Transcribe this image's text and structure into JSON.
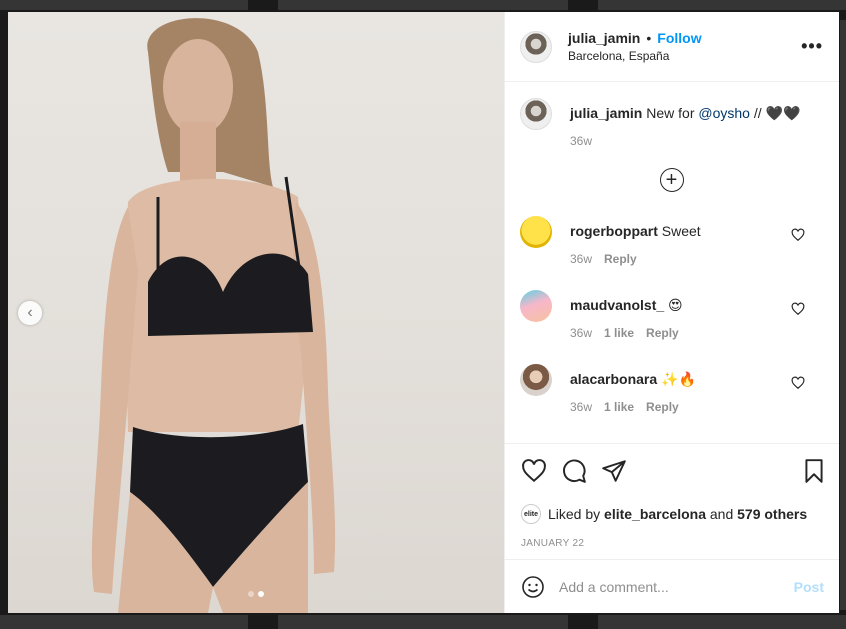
{
  "post": {
    "author": "julia_jamin",
    "follow_label": "Follow",
    "separator": "•",
    "location": "Barcelona, España",
    "more_label": "•••"
  },
  "caption": {
    "author": "julia_jamin",
    "text_prefix": "New for ",
    "mention": "@oysho",
    "text_suffix": " // 🖤🖤",
    "age": "36w"
  },
  "load_more_label": "+",
  "comments": [
    {
      "user": "rogerboppart",
      "text": "Sweet",
      "age": "36w",
      "likes": "",
      "reply": "Reply"
    },
    {
      "user": "maudvanolst_",
      "text": "😍",
      "age": "36w",
      "likes": "1 like",
      "reply": "Reply"
    },
    {
      "user": "alacarbonara",
      "text": "✨🔥",
      "age": "36w",
      "likes": "1 like",
      "reply": "Reply"
    }
  ],
  "likes": {
    "prefix": "Liked by ",
    "user": "elite_barcelona",
    "middle": " and ",
    "others": "579 others",
    "avatar_text": "elite"
  },
  "date": "JANUARY 22",
  "add_comment": {
    "placeholder": "Add a comment...",
    "post_label": "Post",
    "emoji_icon": "smiley-icon"
  },
  "carousel": {
    "prev_label": "‹",
    "slide_count": 2,
    "active_slide": 2
  },
  "colors": {
    "link": "#0095f6",
    "mention": "#00376b",
    "post_disabled": "#b2dffc",
    "muted": "#8e8e8e"
  }
}
